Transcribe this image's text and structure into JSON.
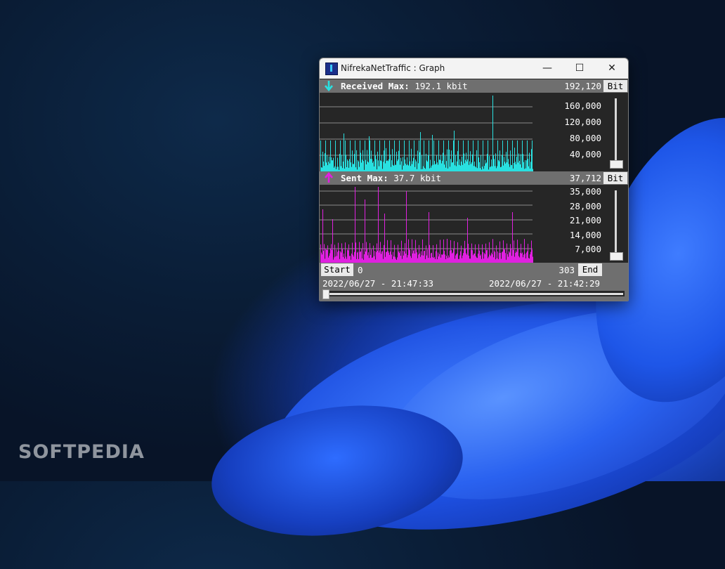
{
  "watermark": "SOFTPEDIA",
  "window": {
    "title": "NifrekaNetTraffic : Graph",
    "controls": {
      "minimize": "—",
      "maximize": "☐",
      "close": "✕"
    }
  },
  "received": {
    "label": "Received Max:",
    "value": "192.1 kbit",
    "max_number": "192,120",
    "unit_button": "Bit",
    "axis": [
      "160,000",
      "120,000",
      "80,000",
      "40,000"
    ],
    "color": "#29e0e0",
    "slider_level": 0.05
  },
  "sent": {
    "label": "Sent Max:",
    "value": "37.7 kbit",
    "max_number": "37,712",
    "unit_button": "Bit",
    "axis": [
      "35,000",
      "28,000",
      "21,000",
      "14,000",
      "7,000"
    ],
    "color": "#e020e0",
    "slider_level": 0.05
  },
  "footer": {
    "start_button": "Start",
    "start_index": "0",
    "end_index": "303",
    "end_button": "End",
    "start_time": "2022/06/27 - 21:47:33",
    "end_time": "2022/06/27 - 21:42:29"
  }
}
